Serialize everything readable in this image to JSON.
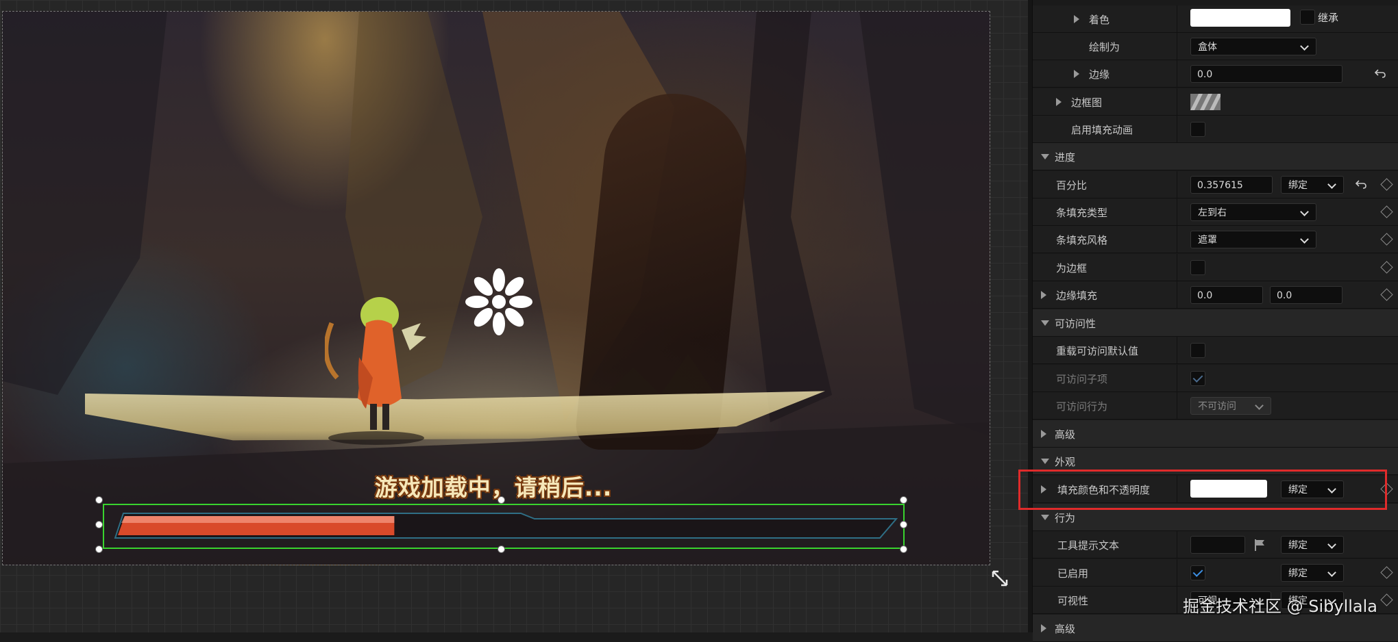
{
  "viewport": {
    "loading_text": "游戏加载中，请稍后...",
    "progress_percent": 0.357615,
    "bar_fill_color": "#d94a2a",
    "bar_frame_color": "#39d42e"
  },
  "details": {
    "tint": {
      "label": "着色",
      "inherit_label": "继承"
    },
    "draw_as": {
      "label": "绘制为",
      "value": "盒体"
    },
    "margin": {
      "label": "边缘",
      "value": "0.0"
    },
    "border_image": {
      "label": "边框图"
    },
    "enable_fill_animation": {
      "label": "启用填充动画"
    },
    "progress_section": {
      "label": "进度"
    },
    "percent": {
      "label": "百分比",
      "value": "0.357615",
      "bind_button": "绑定"
    },
    "bar_fill_type": {
      "label": "条填充类型",
      "value": "左到右"
    },
    "bar_fill_style": {
      "label": "条填充风格",
      "value": "遮罩"
    },
    "is_marquee": {
      "label": "为边框"
    },
    "border_padding": {
      "label": "边缘填充",
      "x": "0.0",
      "y": "0.0"
    },
    "accessibility_section": {
      "label": "可访问性"
    },
    "override_accessible_defaults": {
      "label": "重载可访问默认值"
    },
    "accessible_children": {
      "label": "可访问子项"
    },
    "accessible_behavior": {
      "label": "可访问行为",
      "value": "不可访问"
    },
    "advanced_1": {
      "label": "高级"
    },
    "appearance_section": {
      "label": "外观"
    },
    "fill_color_opacity": {
      "label": "填充颜色和不透明度",
      "bind_button": "绑定"
    },
    "behavior_section": {
      "label": "行为"
    },
    "tooltip_text": {
      "label": "工具提示文本",
      "bind_button": "绑定"
    },
    "is_enabled": {
      "label": "已启用",
      "bind_button": "绑定"
    },
    "visibility": {
      "label": "可视性",
      "value": "可视",
      "bind_button": "绑定"
    },
    "advanced_2": {
      "label": "高级"
    }
  },
  "watermark": "掘金技术社区 @ Sibyllala",
  "colors": {
    "highlight": "#e02b2b",
    "checkbox_accent": "#3d8fe3"
  }
}
